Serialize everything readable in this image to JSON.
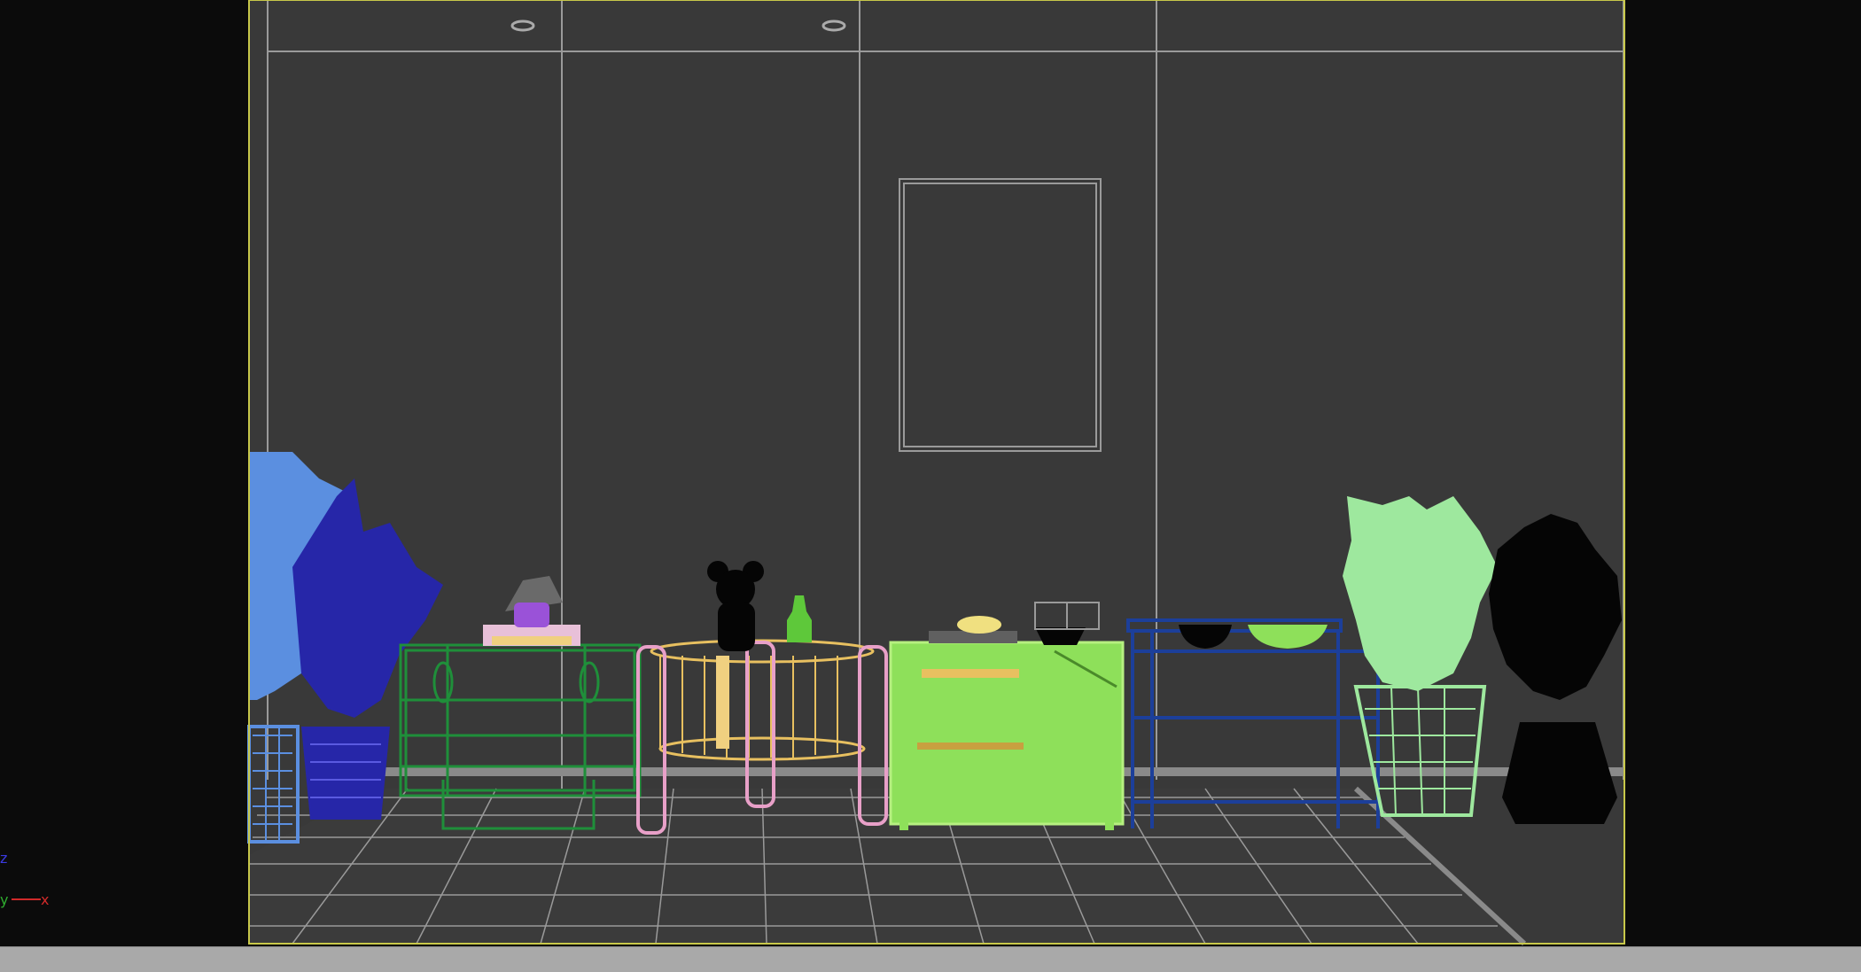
{
  "viewport": {
    "background": "#0b0b0b",
    "wall_color": "#393939",
    "grid_line_color": "#9a9a9a",
    "safe_frame_color": "#c8c84a",
    "wireframe_colors": {
      "plant_light_blue": "#5b8fe0",
      "plant_dark_blue": "#2626a8",
      "dresser_green": "#1f8f3a",
      "table_yellow": "#e8c060",
      "table_legs_pink": "#e8a0c8",
      "cabinet_lime": "#8ee05a",
      "shelf_navy": "#1c3f9a",
      "plant_mint": "#9ee89e",
      "plant_black": "#050505",
      "vase_green": "#5ec83a",
      "lamp_purple": "#9a52d8"
    }
  },
  "axis_gizmo": {
    "z_label": "z",
    "y_label": "y",
    "x_label": "x",
    "z_color": "#3a3ae0",
    "y_color": "#2fae2f",
    "x_color": "#d02a2a"
  }
}
